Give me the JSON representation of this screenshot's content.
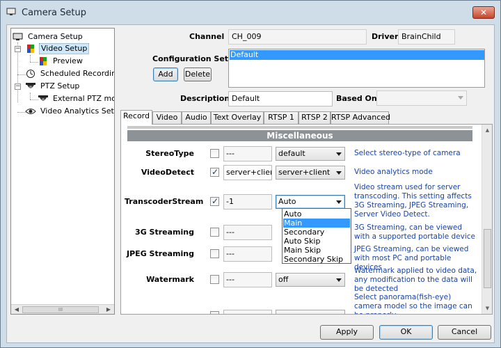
{
  "window": {
    "title": "Camera Setup",
    "close_glyph": "✕"
  },
  "tree": {
    "items": [
      {
        "label": "Camera Setup",
        "icon": "monitor-icon"
      },
      {
        "label": "Video Setup",
        "icon": "color-grid-icon"
      },
      {
        "label": "Preview",
        "icon": "color-grid-icon"
      },
      {
        "label": "Scheduled Recording",
        "icon": "clock-icon"
      },
      {
        "label": "PTZ Setup",
        "icon": "ptz-camera-icon"
      },
      {
        "label": "External PTZ module",
        "icon": "ptz-camera-icon"
      },
      {
        "label": "Video Analytics Setup",
        "icon": "eye-icon"
      }
    ],
    "scroll_left": "◀",
    "scroll_right": "▶",
    "scroll_thumb": "III"
  },
  "header": {
    "channel_label": "Channel",
    "channel_value": "CH_009",
    "driver_label": "Driver",
    "driver_value": "BrainChild",
    "config_label": "Configuration Sets",
    "config_items": [
      "Default"
    ],
    "add_label": "Add",
    "delete_label": "Delete",
    "description_label": "Description",
    "description_value": "Default",
    "based_on_label": "Based On",
    "based_on_value": ""
  },
  "tabs": [
    "Record",
    "Video",
    "Audio",
    "Text Overlay",
    "RTSP 1",
    "RTSP 2",
    "RTSP Advanced"
  ],
  "active_tab": "Record",
  "section": {
    "title": "Miscellaneous"
  },
  "settings": [
    {
      "label": "StereoType",
      "checked": false,
      "value": "---",
      "combo": "default",
      "desc": "Select stereo-type of camera"
    },
    {
      "label": "VideoDetect",
      "checked": true,
      "value": "server+client",
      "combo": "server+client",
      "desc": "Video analytics mode"
    },
    {
      "label": "TranscoderStream",
      "checked": true,
      "value": "-1",
      "combo": "Auto",
      "desc": "Video stream used for server transcoding. This setting affects 3G Streaming, JPEG Streaming, Server Video Detect."
    },
    {
      "label": "3G Streaming",
      "checked": false,
      "value": "---",
      "combo": "",
      "desc": "3G Streaming, can be viewed with a supported portable device"
    },
    {
      "label": "JPEG Streaming",
      "checked": false,
      "value": "---",
      "combo": "",
      "desc": "JPEG Streaming, can be viewed with most PC and portable devices"
    },
    {
      "label": "Watermark",
      "checked": false,
      "value": "---",
      "combo": "off",
      "desc": "Watermark applied to video data, any modification to the data will be detected"
    },
    {
      "label": "",
      "checked": false,
      "value": "",
      "combo": "",
      "desc": "Select panorama(fish-eye) camera model so the image can be properly"
    }
  ],
  "dropdown": {
    "options": [
      "Auto",
      "Main",
      "Secondary",
      "Auto Skip",
      "Main Skip",
      "Secondary Skip"
    ],
    "highlighted": "Main"
  },
  "vscroll": {
    "up": "▲",
    "down": "▼"
  },
  "footer": {
    "apply_label": "Apply",
    "ok_label": "OK",
    "cancel_label": "Cancel"
  },
  "colors": {
    "selection": "#3399ff",
    "description_text": "#1844a8",
    "section_header": "#8d9296"
  }
}
